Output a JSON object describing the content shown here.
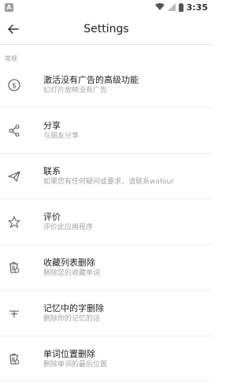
{
  "status": {
    "notif_letter": "A",
    "time": "3:35"
  },
  "appbar": {
    "title": "Settings"
  },
  "section": {
    "label": "常规"
  },
  "items": [
    {
      "icon": "dollar-coin-icon",
      "title": "激活没有广告的高级功能",
      "subtitle": "幻灯片放映没有广告"
    },
    {
      "icon": "share-icon",
      "title": "分享",
      "subtitle": "与朋友分享"
    },
    {
      "icon": "send-paper-plane-icon",
      "title": "联系",
      "subtitle": "如果您有任何疑问或要求，请联系wafour"
    },
    {
      "icon": "star-icon",
      "title": "评价",
      "subtitle": "评价此应用程序"
    },
    {
      "icon": "trash-bin-icon",
      "title": "收藏列表删除",
      "subtitle": "删除您的收藏单词"
    },
    {
      "icon": "text-format-icon",
      "title": "记忆中的字删除",
      "subtitle": "删除你的记忆的话"
    },
    {
      "icon": "trash-bin-icon",
      "title": "单词位置删除",
      "subtitle": "删除单词的最后位置"
    }
  ]
}
